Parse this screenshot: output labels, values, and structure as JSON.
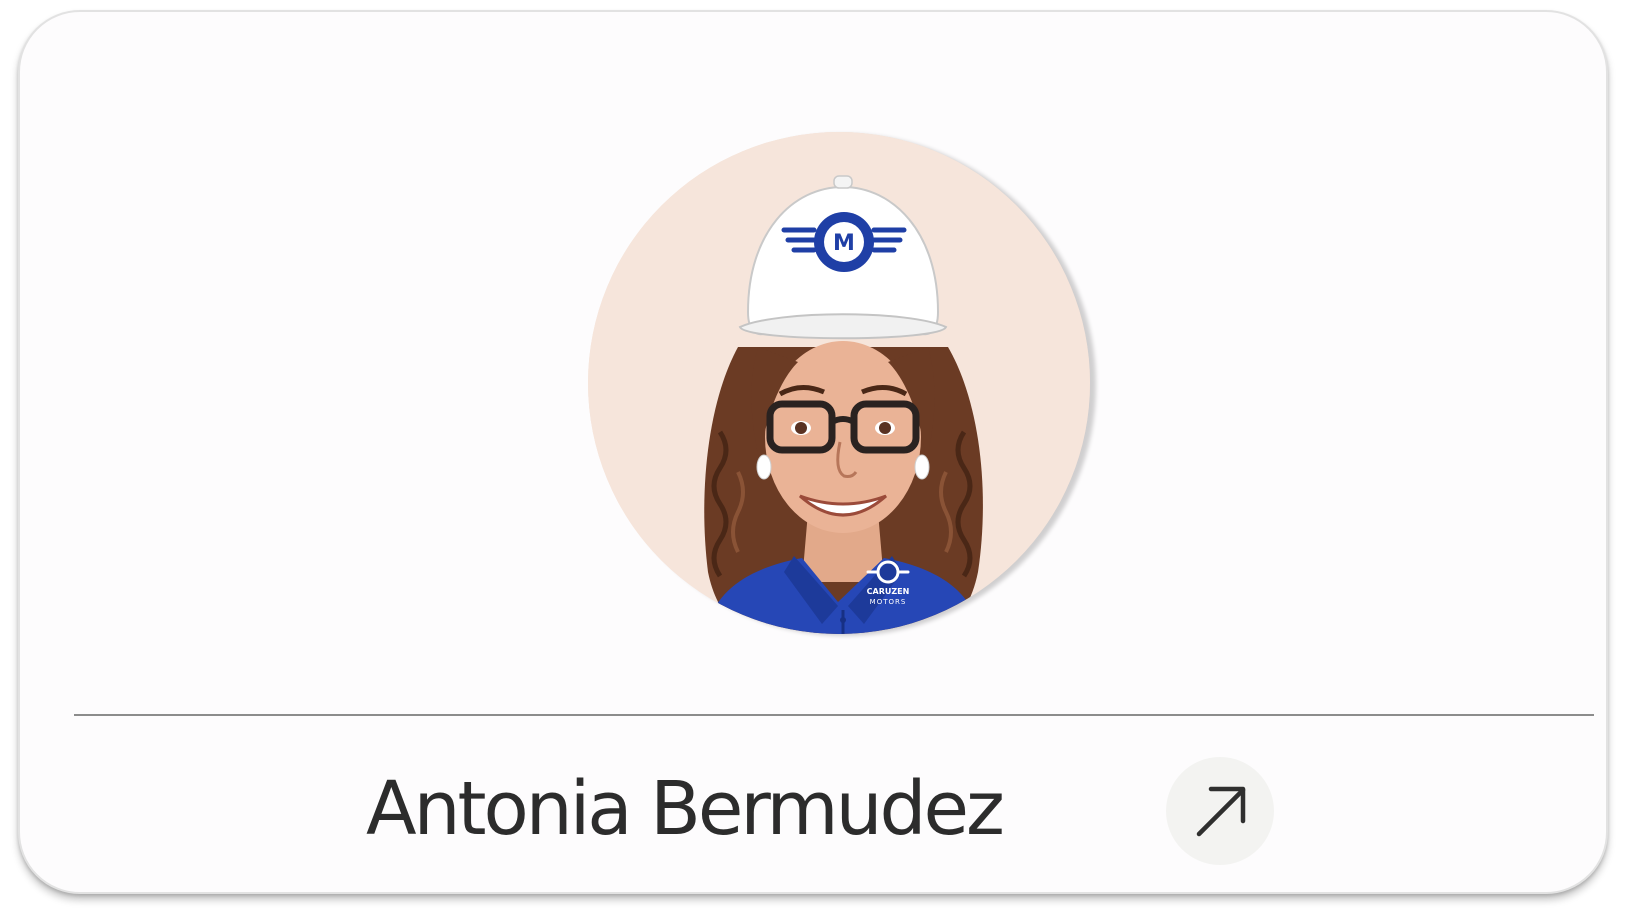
{
  "profile": {
    "name": "Antonia Bermudez",
    "avatar_icon": "profile-avatar-illustration",
    "avatar_background": "#f6e5db",
    "logo_text": {
      "line1": "CARUZEN",
      "line2": "MOTORS"
    }
  },
  "action": {
    "icon": "arrow-up-right-icon"
  },
  "colors": {
    "brand_blue": "#1f3fa6",
    "name_text": "#2c2c2c",
    "divider": "#8c8c8c"
  }
}
